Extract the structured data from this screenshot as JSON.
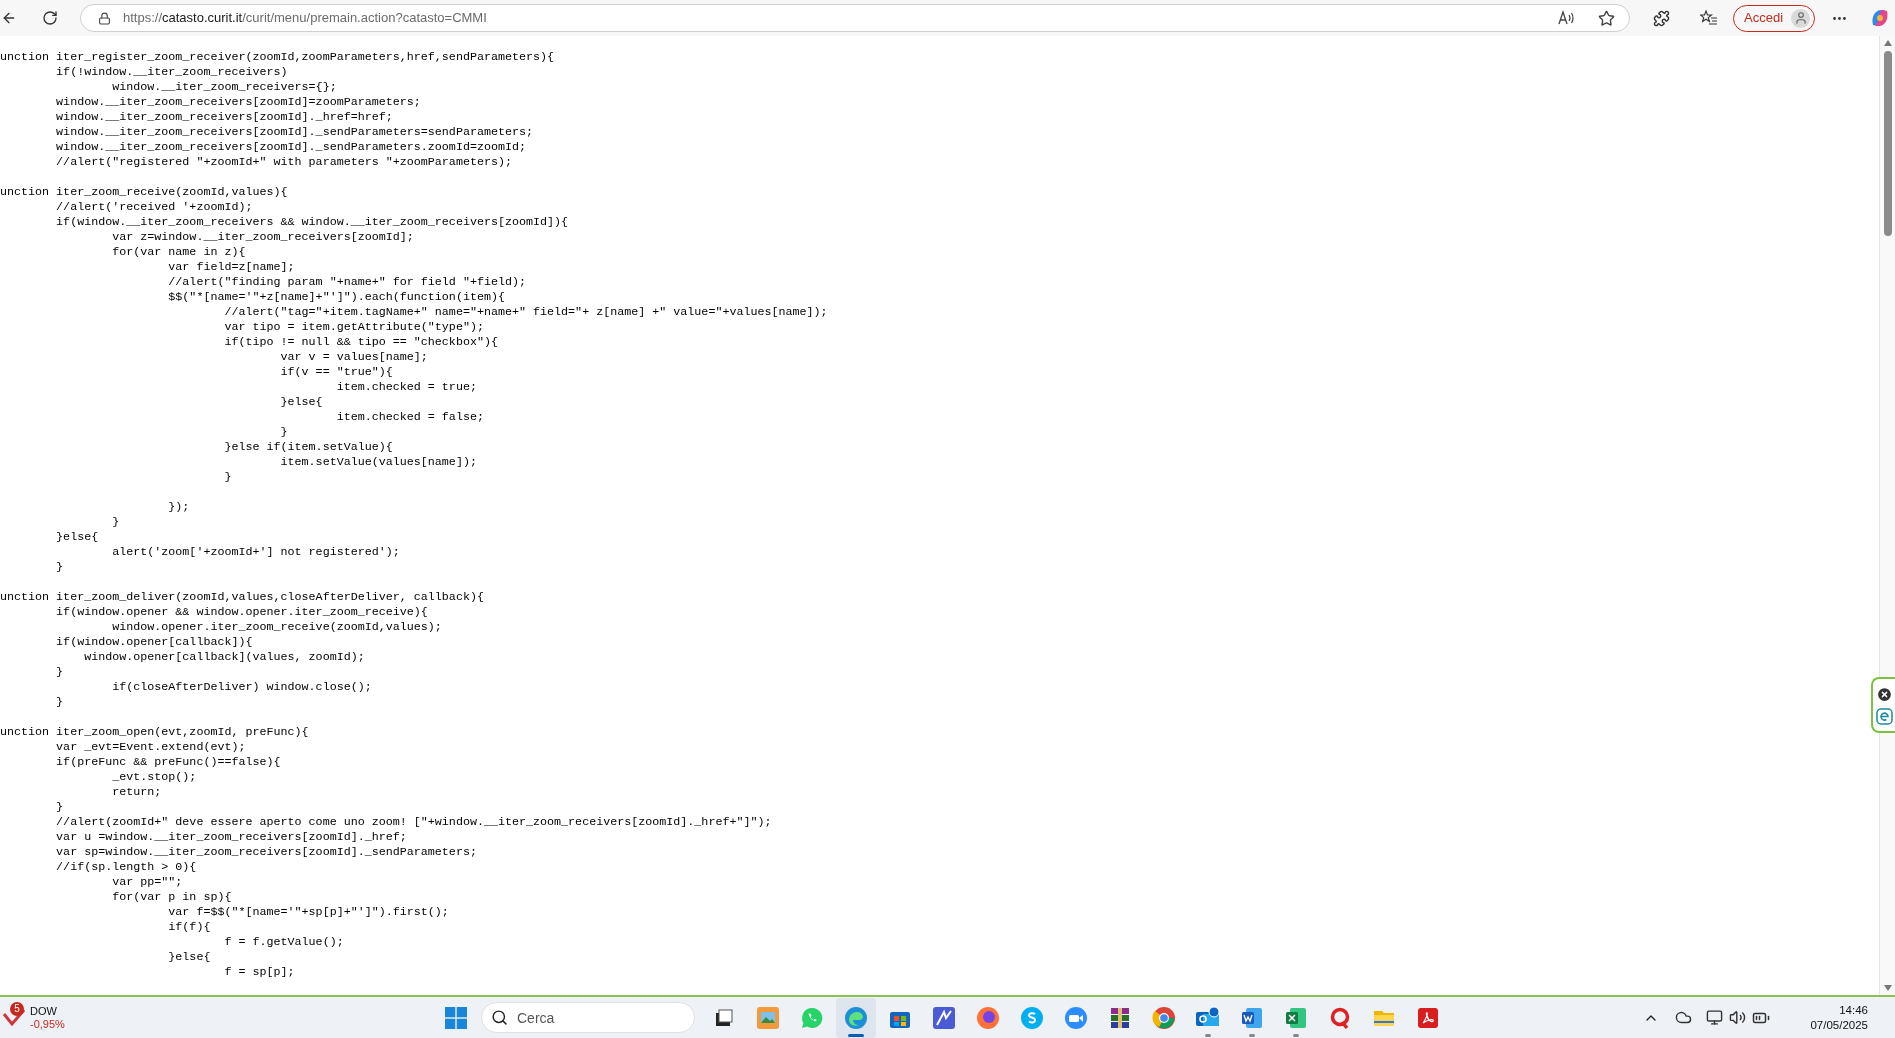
{
  "browser": {
    "url": {
      "scheme": "https://",
      "host": "catasto.curit.it",
      "path": "/curit/menu/premain.action?catasto=CMMI"
    },
    "sign_in": "Accedi"
  },
  "code_blocks": [
    {
      "lines": [
        "unction iter_register_zoom_receiver(zoomId,zoomParameters,href,sendParameters){",
        "\tif(!window.__iter_zoom_receivers)",
        "\t\twindow.__iter_zoom_receivers={};",
        "\twindow.__iter_zoom_receivers[zoomId]=zoomParameters;",
        "\twindow.__iter_zoom_receivers[zoomId]._href=href;",
        "\twindow.__iter_zoom_receivers[zoomId]._sendParameters=sendParameters;",
        "\twindow.__iter_zoom_receivers[zoomId]._sendParameters.zoomId=zoomId;",
        "\t//alert(\"registered \"+zoomId+\" with parameters \"+zoomParameters);"
      ]
    },
    {
      "lines": [
        "unction iter_zoom_receive(zoomId,values){",
        "\t//alert('received '+zoomId);",
        "\tif(window.__iter_zoom_receivers && window.__iter_zoom_receivers[zoomId]){",
        "\t\tvar z=window.__iter_zoom_receivers[zoomId];",
        "\t\tfor(var name in z){",
        "\t\t\tvar field=z[name];",
        "\t\t\t//alert(\"finding param \"+name+\" for field \"+field);",
        "\t\t\t$$(\"*[name='\"+z[name]+\"']\").each(function(item){",
        "\t\t\t\t//alert(\"tag=\"+item.tagName+\" name=\"+name+\" field=\"+ z[name] +\" value=\"+values[name]);",
        "\t\t\t\tvar tipo = item.getAttribute(\"type\");",
        "\t\t\t\tif(tipo != null && tipo == \"checkbox\"){",
        "\t\t\t\t\tvar v = values[name];",
        "\t\t\t\t\tif(v == \"true\"){",
        "\t\t\t\t\t\titem.checked = true;",
        "\t\t\t\t\t}else{",
        "\t\t\t\t\t\titem.checked = false;",
        "\t\t\t\t\t}",
        "\t\t\t\t}else if(item.setValue){",
        "\t\t\t\t\titem.setValue(values[name]);",
        "\t\t\t\t}"
      ]
    },
    {
      "lines": [
        "\t\t\t});",
        "\t\t}",
        "\t}else{",
        "\t\talert('zoom['+zoomId+'] not registered');",
        "\t}"
      ]
    },
    {
      "lines": [
        "unction iter_zoom_deliver(zoomId,values,closeAfterDeliver, callback){",
        "\tif(window.opener && window.opener.iter_zoom_receive){",
        "\t\twindow.opener.iter_zoom_receive(zoomId,values);",
        "\tif(window.opener[callback]){",
        "\t    window.opener[callback](values, zoomId);",
        "\t}",
        "\t\tif(closeAfterDeliver) window.close();",
        "\t}"
      ]
    },
    {
      "lines": [
        "unction iter_zoom_open(evt,zoomId, preFunc){",
        "\tvar _evt=Event.extend(evt);",
        "\tif(preFunc && preFunc()==false){",
        "\t\t_evt.stop();",
        "\t\treturn;",
        "\t}",
        "\t//alert(zoomId+\" deve essere aperto come uno zoom! [\"+window.__iter_zoom_receivers[zoomId]._href+\"]\");",
        "\tvar u =window.__iter_zoom_receivers[zoomId]._href;",
        "\tvar sp=window.__iter_zoom_receivers[zoomId]._sendParameters;",
        "\t//if(sp.length > 0){",
        "\t\tvar pp=\"\";",
        "\t\tfor(var p in sp){",
        "\t\t\tvar f=$$(\"*[name='\"+sp[p]+\"']\").first();",
        "\t\t\tif(f){",
        "\t\t\t\tf = f.getValue();",
        "\t\t\t}else{",
        "\t\t\t\tf = sp[p];"
      ]
    }
  ],
  "taskbar": {
    "widget": {
      "badge": "5",
      "name": "DOW",
      "change": "-0,95%"
    },
    "search_placeholder": "Cerca",
    "apps": [
      {
        "kind": "taskview",
        "running": false,
        "active": false
      },
      {
        "kind": "photo",
        "running": false,
        "active": false
      },
      {
        "kind": "chat",
        "running": false,
        "active": false
      },
      {
        "kind": "browser",
        "running": true,
        "active": true
      },
      {
        "kind": "store",
        "running": false,
        "active": false
      },
      {
        "kind": "pen",
        "running": false,
        "active": false
      },
      {
        "kind": "fox",
        "running": false,
        "active": false
      },
      {
        "kind": "cloud",
        "running": false,
        "active": false
      },
      {
        "kind": "video",
        "running": false,
        "active": false
      },
      {
        "kind": "archive",
        "running": false,
        "active": false
      },
      {
        "kind": "globe",
        "running": false,
        "active": false
      },
      {
        "kind": "mail",
        "running": true,
        "active": false
      },
      {
        "kind": "doc",
        "running": true,
        "active": false
      },
      {
        "kind": "sheet",
        "running": true,
        "active": false
      },
      {
        "kind": "q",
        "running": false,
        "active": false
      },
      {
        "kind": "folder",
        "running": false,
        "active": false
      },
      {
        "kind": "pdf",
        "running": false,
        "active": false
      }
    ],
    "time": "14:46",
    "date": "07/05/2025"
  }
}
